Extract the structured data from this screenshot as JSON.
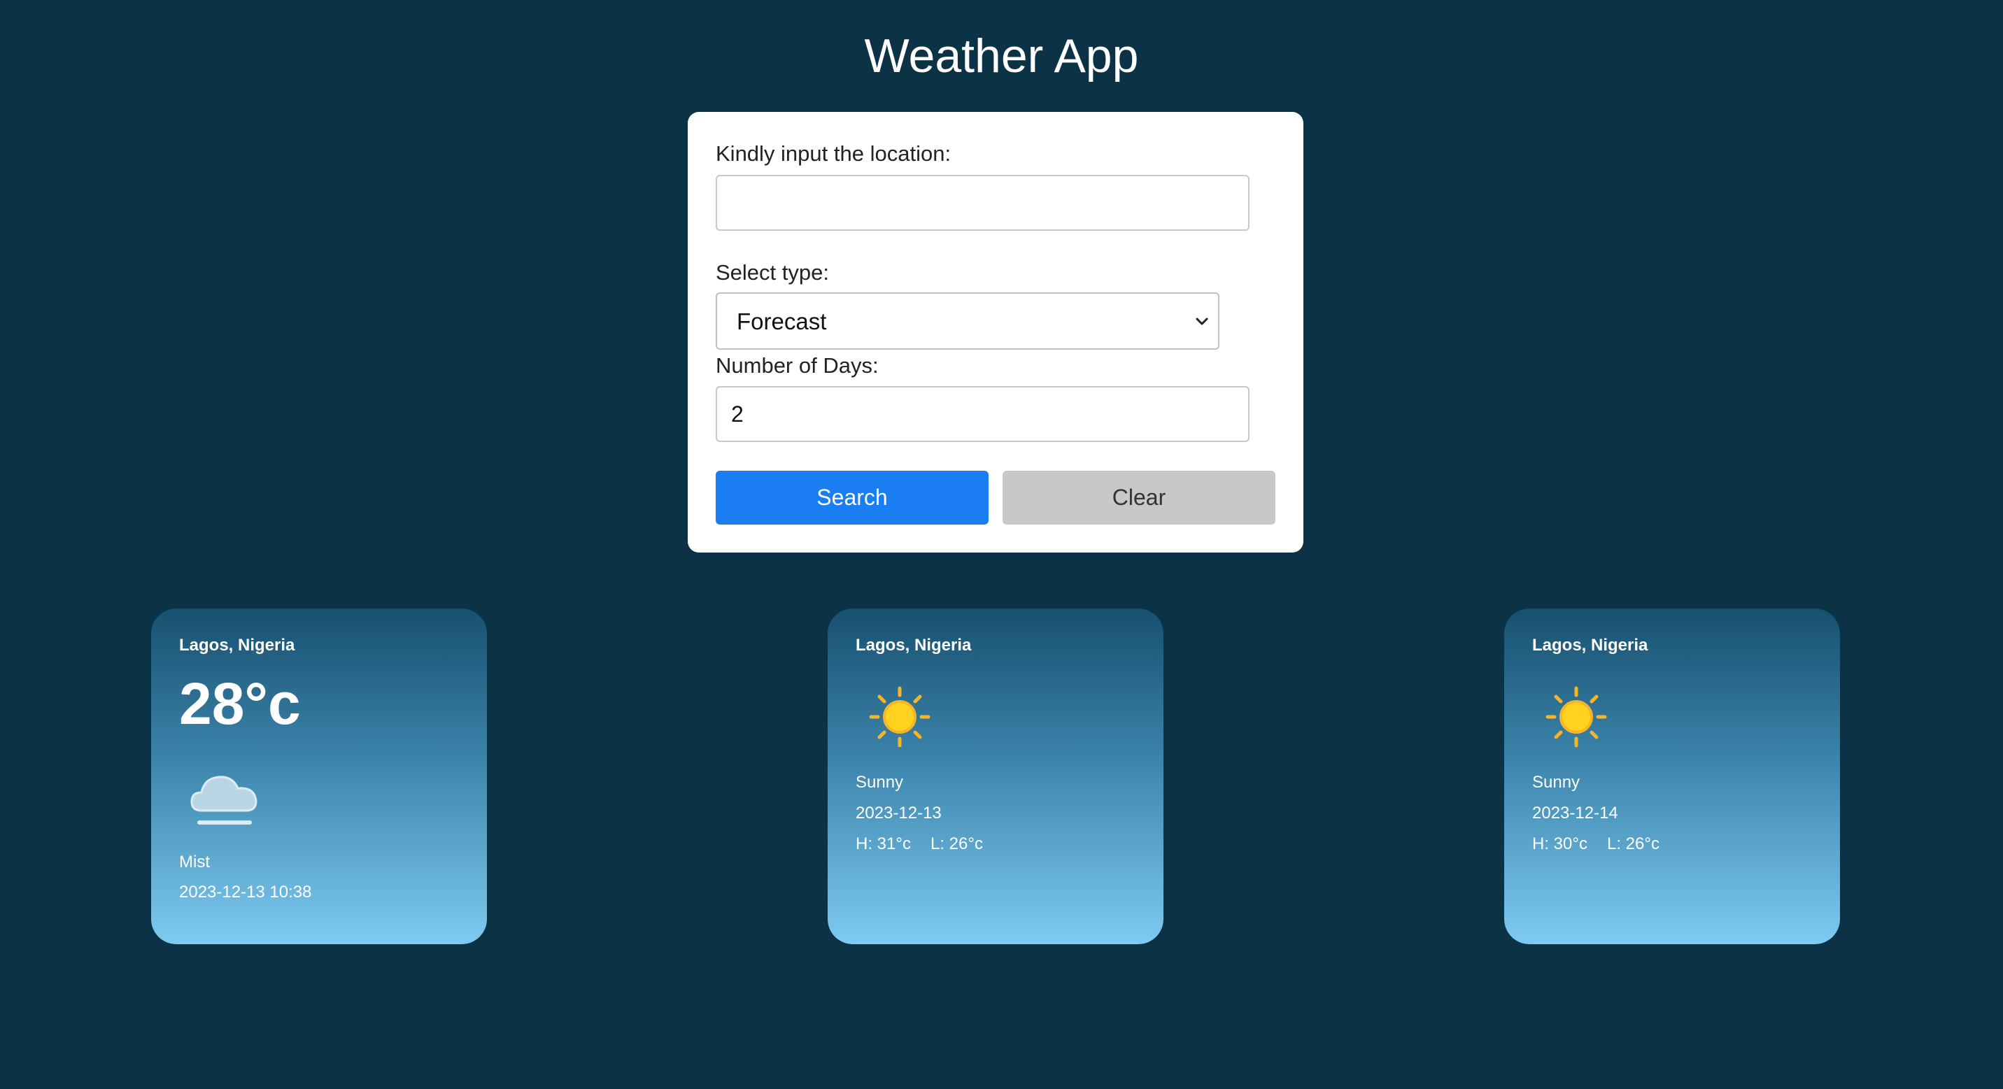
{
  "app": {
    "title": "Weather App"
  },
  "form": {
    "location_label": "Kindly input the location:",
    "location_value": "",
    "type_label": "Select type:",
    "type_selected": "Forecast",
    "days_label": "Number of Days:",
    "days_value": "2",
    "search_label": "Search",
    "clear_label": "Clear"
  },
  "cards": [
    {
      "location": "Lagos, Nigeria",
      "temperature": "28°c",
      "icon": "mist-cloud-icon",
      "condition": "Mist",
      "datetime": "2023-12-13 10:38"
    },
    {
      "location": "Lagos, Nigeria",
      "icon": "sun-icon",
      "condition": "Sunny",
      "date": "2023-12-13",
      "high": "H: 31°c",
      "low": "L: 26°c"
    },
    {
      "location": "Lagos, Nigeria",
      "icon": "sun-icon",
      "condition": "Sunny",
      "date": "2023-12-14",
      "high": "H: 30°c",
      "low": "L: 26°c"
    }
  ],
  "colors": {
    "background": "#0c3245",
    "search_button": "#1a7ef2",
    "clear_button": "#c8c8c8",
    "card_gradient_top": "#17506f",
    "card_gradient_bottom": "#7ecaf0"
  }
}
